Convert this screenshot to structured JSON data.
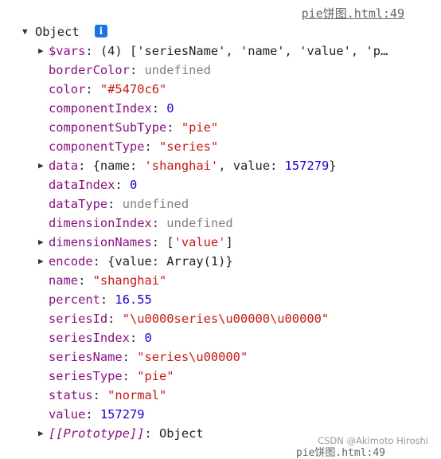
{
  "header": {
    "source_link": "pie饼图.html:49"
  },
  "root": {
    "label": "Object",
    "info_icon": "info-icon"
  },
  "props": {
    "vars_key": "$vars",
    "vars_value": "(4) ['seriesName', 'name', 'value', 'p…",
    "borderColor": {
      "key": "borderColor",
      "value": "undefined"
    },
    "color": {
      "key": "color",
      "value": "\"#5470c6\""
    },
    "componentIndex": {
      "key": "componentIndex",
      "value": "0"
    },
    "componentSubType": {
      "key": "componentSubType",
      "value": "\"pie\""
    },
    "componentType": {
      "key": "componentType",
      "value": "\"series\""
    },
    "data": {
      "key": "data",
      "open": "{",
      "name_key": "name",
      "name_value": "'shanghai'",
      "value_key": "value",
      "value_value": "157279",
      "close": "}"
    },
    "dataIndex": {
      "key": "dataIndex",
      "value": "0"
    },
    "dataType": {
      "key": "dataType",
      "value": "undefined"
    },
    "dimensionIndex": {
      "key": "dimensionIndex",
      "value": "undefined"
    },
    "dimensionNames": {
      "key": "dimensionNames",
      "open": "[",
      "value": "'value'",
      "close": "]"
    },
    "encode": {
      "key": "encode",
      "value": "{value: Array(1)}"
    },
    "name": {
      "key": "name",
      "value": "\"shanghai\""
    },
    "percent": {
      "key": "percent",
      "value": "16.55"
    },
    "seriesId": {
      "key": "seriesId",
      "value": "\"\\u0000series\\u00000\\u00000\""
    },
    "seriesIndex": {
      "key": "seriesIndex",
      "value": "0"
    },
    "seriesName": {
      "key": "seriesName",
      "value": "\"series\\u00000\""
    },
    "seriesType": {
      "key": "seriesType",
      "value": "\"pie\""
    },
    "status": {
      "key": "status",
      "value": "\"normal\""
    },
    "value": {
      "key": "value",
      "value": "157279"
    },
    "prototype": {
      "key": "[[Prototype]]",
      "value": "Object"
    }
  },
  "footer": {
    "watermark": "CSDN @Akimoto Hiroshi",
    "cutoff_text": "pie饼图.html:49"
  },
  "colors": {
    "key": "#881280",
    "string": "#c41a16",
    "number": "#1c00cf",
    "undefined": "#808080",
    "info": "#1a73e8"
  }
}
